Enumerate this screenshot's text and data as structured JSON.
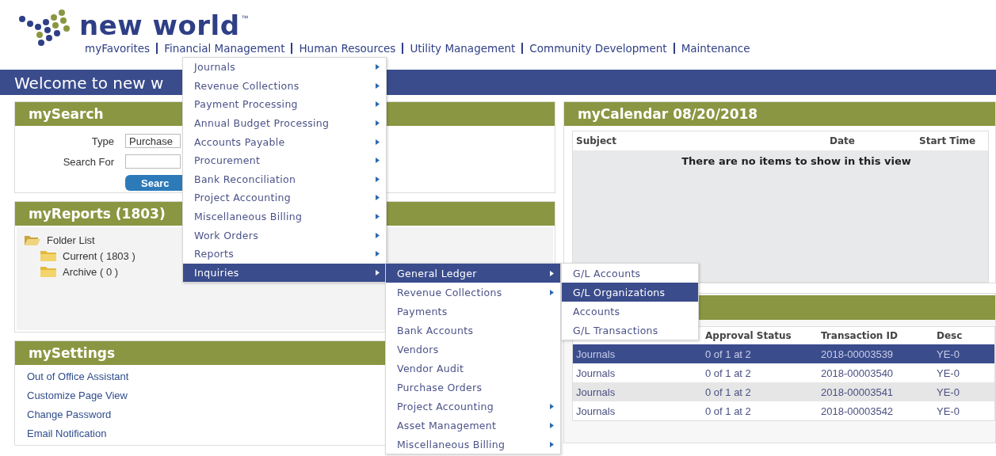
{
  "header": {
    "logo_text": "new world",
    "trademark": "™",
    "nav": [
      {
        "label": "myFavorites"
      },
      {
        "label": "Financial Management"
      },
      {
        "label": "Human Resources"
      },
      {
        "label": "Utility Management"
      },
      {
        "label": "Community Development"
      },
      {
        "label": "Maintenance"
      }
    ]
  },
  "banner": {
    "text": "Welcome to new w"
  },
  "search_panel": {
    "title": "mySearch",
    "type_label": "Type",
    "type_value": "Purchase",
    "search_label": "Search For",
    "button": "Searc"
  },
  "reports_panel": {
    "title": "myReports (1803)",
    "tree": [
      {
        "label": "Folder List",
        "expanded": true,
        "children": [
          {
            "label": "Current ( 1803 )",
            "expanded": false
          },
          {
            "label": "Archive ( 0 )",
            "expanded": false
          }
        ]
      }
    ]
  },
  "settings_panel": {
    "title": "mySettings",
    "links": [
      "Out of Office Assistant",
      "Customize Page View",
      "Change Password",
      "Email Notification"
    ]
  },
  "calendar_panel": {
    "title": "myCalendar 08/20/2018",
    "columns": [
      "Subject",
      "Date",
      "Start Time"
    ],
    "empty_message": "There are no items to show in this view"
  },
  "approvals_panel": {
    "columns": [
      "Approval Status",
      "Transaction ID",
      "Desc"
    ],
    "rows": [
      {
        "column_1": "Journals",
        "approval_status": "0 of 1 at 2",
        "transaction_id": "2018-00003539",
        "column_4": "YE-0",
        "selected": true
      },
      {
        "column_1": "Journals",
        "approval_status": "0 of 1 at 2",
        "transaction_id": "2018-00003540",
        "column_4": "YE-0",
        "selected": false
      },
      {
        "column_1": "Journals",
        "approval_status": "0 of 1 at 2",
        "transaction_id": "2018-00003541",
        "column_4": "YE-0",
        "selected": false
      },
      {
        "column_1": "Journals",
        "approval_status": "0 of 1 at 2",
        "transaction_id": "2018-00003542",
        "column_4": "YE-0",
        "selected": false
      }
    ]
  },
  "menus": [
    {
      "items": [
        {
          "label": "Journals",
          "submenu": true,
          "selected": false
        },
        {
          "label": "Revenue Collections",
          "submenu": true,
          "selected": false
        },
        {
          "label": "Payment Processing",
          "submenu": true,
          "selected": false
        },
        {
          "label": "Annual Budget Processing",
          "submenu": true,
          "selected": false
        },
        {
          "label": "Accounts Payable",
          "submenu": true,
          "selected": false
        },
        {
          "label": "Procurement",
          "submenu": true,
          "selected": false
        },
        {
          "label": "Bank Reconciliation",
          "submenu": true,
          "selected": false
        },
        {
          "label": "Project Accounting",
          "submenu": true,
          "selected": false
        },
        {
          "label": "Miscellaneous Billing",
          "submenu": true,
          "selected": false
        },
        {
          "label": "Work Orders",
          "submenu": true,
          "selected": false
        },
        {
          "label": "Reports",
          "submenu": true,
          "selected": false
        },
        {
          "label": "Inquiries",
          "submenu": true,
          "selected": true
        }
      ]
    },
    {
      "items": [
        {
          "label": "General Ledger",
          "submenu": true,
          "selected": true
        },
        {
          "label": "Revenue Collections",
          "submenu": true,
          "selected": false
        },
        {
          "label": "Payments",
          "submenu": false,
          "selected": false
        },
        {
          "label": "Bank Accounts",
          "submenu": false,
          "selected": false
        },
        {
          "label": "Vendors",
          "submenu": false,
          "selected": false
        },
        {
          "label": "Vendor Audit",
          "submenu": false,
          "selected": false
        },
        {
          "label": "Purchase Orders",
          "submenu": false,
          "selected": false
        },
        {
          "label": "Project Accounting",
          "submenu": true,
          "selected": false
        },
        {
          "label": "Asset Management",
          "submenu": true,
          "selected": false
        },
        {
          "label": "Miscellaneous Billing",
          "submenu": true,
          "selected": false
        }
      ]
    },
    {
      "items": [
        {
          "label": "G/L Accounts",
          "submenu": false,
          "selected": false
        },
        {
          "label": "G/L Organizations",
          "submenu": false,
          "selected": true
        },
        {
          "label": "Accounts",
          "submenu": false,
          "selected": false
        },
        {
          "label": "G/L Transactions",
          "submenu": false,
          "selected": false
        }
      ]
    }
  ]
}
